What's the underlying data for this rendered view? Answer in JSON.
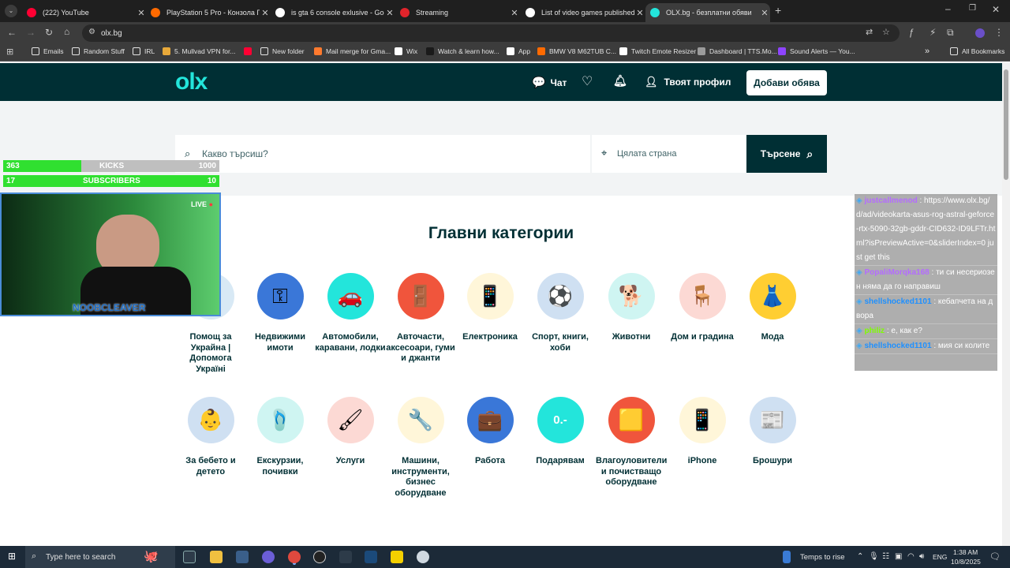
{
  "browser": {
    "tabs": [
      {
        "label": "(222) YouTube",
        "color": "#ff0033"
      },
      {
        "label": "PlayStation 5 Pro - Конзола Пл",
        "color": "#ff6a00"
      },
      {
        "label": "is gta 6 console exlusive - Goo",
        "color": "#ffffff"
      },
      {
        "label": "Streaming",
        "color": "#e0242b"
      },
      {
        "label": "List of video games published b",
        "color": "#ffffff"
      },
      {
        "label": "OLX.bg - безплатни обяви",
        "color": "#23e5db"
      }
    ],
    "url": "olx.bg",
    "bookmarks": [
      "Emails",
      "Random Stuff",
      "IRL",
      "5. Mullvad VPN for...",
      "",
      "New folder",
      "Mail merge for Gma...",
      "Wix",
      "Watch & learn how...",
      "App",
      "BMW V8 M62TUB C...",
      "Twitch Emote Resizer",
      "Dashboard | TTS.Mo...",
      "Sound Alerts — You..."
    ],
    "all_bookmarks": "All Bookmarks",
    "overflow": "»"
  },
  "header": {
    "logo": "olx",
    "chat": "Чат",
    "profile": "Твоят профил",
    "add_listing": "Добави обява"
  },
  "search": {
    "placeholder": "Какво търсиш?",
    "location_placeholder": "Цялата страна",
    "button": "Търсене"
  },
  "categories": {
    "title": "Главни категории",
    "items": [
      {
        "label": "Помощ за Украйна | Допомога Україні",
        "icon": "ukraine-help-icon",
        "bg": "#d8e9f5",
        "glyph": ""
      },
      {
        "label": "Недвижими имоти",
        "icon": "keys-icon",
        "bg": "#3a77d8",
        "glyph": "⚿"
      },
      {
        "label": "Автомобили, каравани, лодки",
        "icon": "car-icon",
        "bg": "#23e5db",
        "glyph": "🚗"
      },
      {
        "label": "Авточасти, аксесоари, гуми и джанти",
        "icon": "car-door-icon",
        "bg": "#f0553c",
        "glyph": "🚪"
      },
      {
        "label": "Електроника",
        "icon": "smartphone-icon",
        "bg": "#fff6d9",
        "glyph": "📱"
      },
      {
        "label": "Спорт, книги, хоби",
        "icon": "football-icon",
        "bg": "#cfe0f2",
        "glyph": "⚽"
      },
      {
        "label": "Животни",
        "icon": "dog-icon",
        "bg": "#cff5f2",
        "glyph": "🐕"
      },
      {
        "label": "Дом и градина",
        "icon": "armchair-icon",
        "bg": "#fcd9d4",
        "glyph": "🪑"
      },
      {
        "label": "Мода",
        "icon": "dress-icon",
        "bg": "#ffce32",
        "glyph": "👗"
      },
      {
        "label": "За бебето и детето",
        "icon": "stroller-icon",
        "bg": "#cfe0f2",
        "glyph": "👶"
      },
      {
        "label": "Екскурзии, почивки",
        "icon": "flip-flops-icon",
        "bg": "#cff5f2",
        "glyph": "🩴"
      },
      {
        "label": "Услуги",
        "icon": "paint-roller-icon",
        "bg": "#fcd9d4",
        "glyph": "🖌"
      },
      {
        "label": "Машини, инструменти, бизнес оборудване",
        "icon": "wrench-icon",
        "bg": "#fff6d9",
        "glyph": "🔧"
      },
      {
        "label": "Работа",
        "icon": "briefcase-icon",
        "bg": "#3a77d8",
        "glyph": "💼"
      },
      {
        "label": "Подарявам",
        "icon": "gift-tag-icon",
        "bg": "#23e5db",
        "glyph": "0.-"
      },
      {
        "label": "Влагоуловители и почистващо оборудване",
        "icon": "dehumidifier-icon",
        "bg": "#f0553c",
        "glyph": "🟨"
      },
      {
        "label": "iPhone",
        "icon": "iphone-icon",
        "bg": "#fff6d9",
        "glyph": "📱"
      },
      {
        "label": "Брошури",
        "icon": "brochure-icon",
        "bg": "#cfe0f2",
        "glyph": "📰"
      }
    ]
  },
  "stream_overlay": {
    "kicks": {
      "current": "363",
      "label": "KICKS",
      "goal": "1000",
      "progress": 0.363
    },
    "subscribers": {
      "current": "17",
      "label": "SUBSCRIBERS",
      "goal": "10",
      "progress": 1.0
    },
    "live": "LIVE",
    "streamer": "NOOBCLEAVER"
  },
  "chat": [
    {
      "user": "justcallmenod",
      "color": "#b46bff",
      "text": ": https://www.olx.bg/d/ad/videokarta-asus-rog-astral-geforce-rtx-5090-32gb-gddr-CID632-ID9LFTr.html?isPreviewActive=0&sliderIndex=0 just get this"
    },
    {
      "user": "PopaliMorqka168",
      "color": "#b46bff",
      "text": ": ти си несериозен няма да го направиш"
    },
    {
      "user": "shellshocked1101",
      "color": "#1e90ff",
      "text": ": кебапчета на двора"
    },
    {
      "user": "philiz",
      "color": "#7fff00",
      "text": ": е, как е?"
    },
    {
      "user": "shellshocked1101",
      "color": "#1e90ff",
      "text": ": мия си колите"
    }
  ],
  "taskbar": {
    "search_placeholder": "Type here to search",
    "weather": "Temps to rise",
    "language": "ENG",
    "time": "1:38 AM",
    "date": "10/8/2025"
  }
}
